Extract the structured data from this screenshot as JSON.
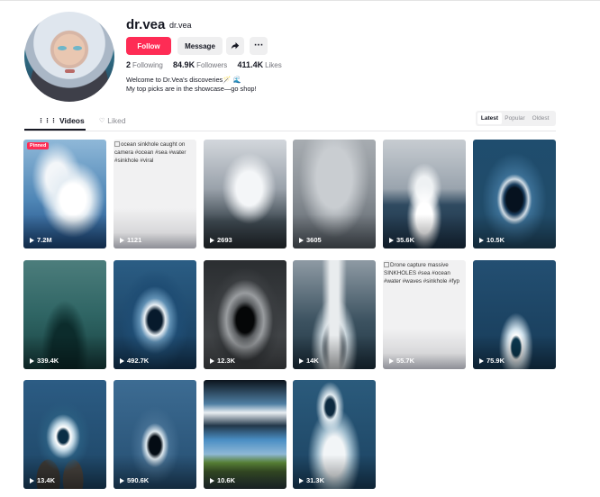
{
  "profile": {
    "username": "dr.vea",
    "nickname": "dr.vea",
    "follow_label": "Follow",
    "message_label": "Message",
    "more_label": "···",
    "stats": {
      "following_count": "2",
      "following_label": "Following",
      "followers_count": "84.9K",
      "followers_label": "Followers",
      "likes_count": "411.4K",
      "likes_label": "Likes"
    },
    "bio_line1": "Welcome to Dr.Vea's discoveries🪄 🌊",
    "bio_line2": "My top picks are in the showcase—go shop!"
  },
  "tabs": [
    {
      "label": "Videos",
      "icon": "grid-icon",
      "active": true
    },
    {
      "label": "Liked",
      "icon": "heart-lock-icon",
      "active": false
    }
  ],
  "sort": {
    "options": [
      "Latest",
      "Popular",
      "Oldest"
    ],
    "selected": "Latest"
  },
  "videos": [
    {
      "views": "7.2M",
      "pinned_label": "Pinned",
      "thumb": "splash"
    },
    {
      "views": "1121",
      "alt_text": "ocean sinkhole caught on camera #ocean #sea #water #sinkhole #viral",
      "thumb": "blank"
    },
    {
      "views": "2693",
      "thumb": "cliff"
    },
    {
      "views": "3605",
      "thumb": "fog"
    },
    {
      "views": "35.6K",
      "thumb": "geyser"
    },
    {
      "views": "10.5K",
      "thumb": "vortex"
    },
    {
      "views": "339.4K",
      "thumb": "wave"
    },
    {
      "views": "492.7K",
      "thumb": "swirl"
    },
    {
      "views": "12.3K",
      "thumb": "dark"
    },
    {
      "views": "14K",
      "thumb": "column"
    },
    {
      "views": "55.7K",
      "alt_text": "Drone capture massive SINKHOLES #sea #ocean #water #waves #sinkhole #fyp",
      "thumb": "blank"
    },
    {
      "views": "75.9K",
      "thumb": "ring"
    },
    {
      "views": "13.4K",
      "thumb": "ring2"
    },
    {
      "views": "590.6K",
      "thumb": "hole"
    },
    {
      "views": "10.6K",
      "thumb": "aerial"
    },
    {
      "views": "31.3K",
      "thumb": "swirl2"
    }
  ],
  "colors": {
    "accent": "#fe2c55",
    "text_primary": "#161823",
    "text_secondary": "#73747b"
  }
}
